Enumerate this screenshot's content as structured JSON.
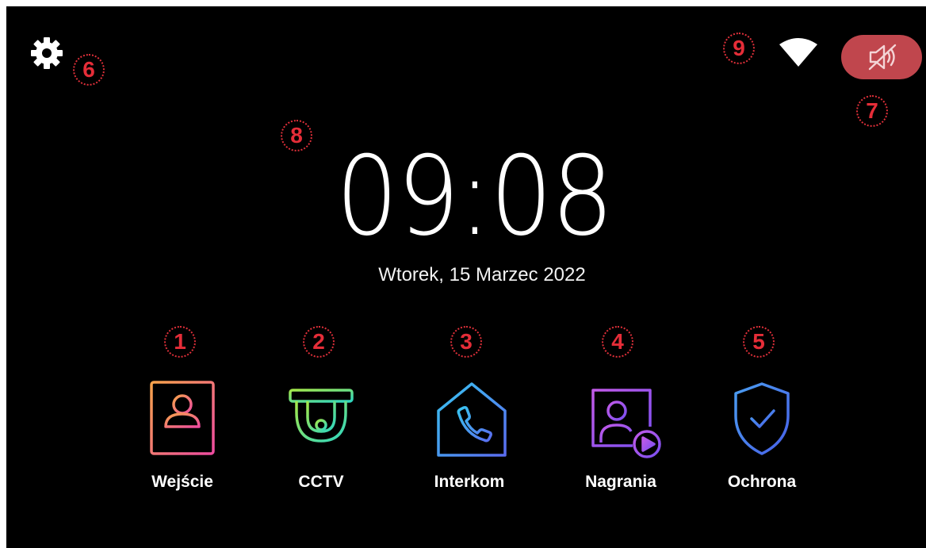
{
  "header": {
    "settings_icon": "gear-icon",
    "wifi_icon": "wifi-icon",
    "mute_icon": "speaker-muted-icon",
    "mute_button_color": "#c0464d"
  },
  "clock": {
    "time": "09:08",
    "date": "Wtorek, 15 Marzec 2022"
  },
  "tiles": [
    {
      "label": "Wejście",
      "icon": "door-station-icon",
      "color": "#f26e8e"
    },
    {
      "label": "CCTV",
      "icon": "dome-camera-icon",
      "color": "#3ddc97"
    },
    {
      "label": "Interkom",
      "icon": "house-phone-icon",
      "color": "#3aa6f0"
    },
    {
      "label": "Nagrania",
      "icon": "recording-icon",
      "color": "#a855e8"
    },
    {
      "label": "Ochrona",
      "icon": "shield-check-icon",
      "color": "#3b8bef"
    }
  ],
  "callouts": [
    "1",
    "2",
    "3",
    "4",
    "5",
    "6",
    "7",
    "8",
    "9"
  ]
}
